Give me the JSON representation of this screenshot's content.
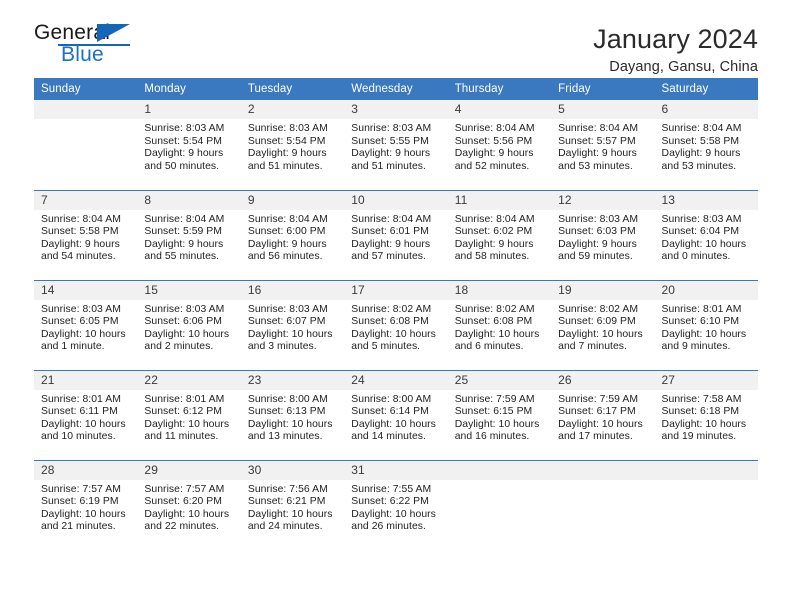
{
  "logo": {
    "word_one": "General",
    "word_two": "Blue",
    "triangle_color": "#1565b8",
    "blue_text_color": "#1c71c4"
  },
  "header": {
    "title": "January 2024",
    "location": "Dayang, Gansu, China"
  },
  "theme": {
    "header_blue": "#3a79c0",
    "daynum_gray": "#f1f1f1",
    "row_divider": "#3a79c0"
  },
  "weekday_headers": [
    "Sunday",
    "Monday",
    "Tuesday",
    "Wednesday",
    "Thursday",
    "Friday",
    "Saturday"
  ],
  "weeks": [
    [
      {
        "day": "",
        "sunrise": "",
        "sunset": "",
        "daylight_line1": "",
        "daylight_line2": ""
      },
      {
        "day": "1",
        "sunrise": "Sunrise: 8:03 AM",
        "sunset": "Sunset: 5:54 PM",
        "daylight_line1": "Daylight: 9 hours",
        "daylight_line2": "and 50 minutes."
      },
      {
        "day": "2",
        "sunrise": "Sunrise: 8:03 AM",
        "sunset": "Sunset: 5:54 PM",
        "daylight_line1": "Daylight: 9 hours",
        "daylight_line2": "and 51 minutes."
      },
      {
        "day": "3",
        "sunrise": "Sunrise: 8:03 AM",
        "sunset": "Sunset: 5:55 PM",
        "daylight_line1": "Daylight: 9 hours",
        "daylight_line2": "and 51 minutes."
      },
      {
        "day": "4",
        "sunrise": "Sunrise: 8:04 AM",
        "sunset": "Sunset: 5:56 PM",
        "daylight_line1": "Daylight: 9 hours",
        "daylight_line2": "and 52 minutes."
      },
      {
        "day": "5",
        "sunrise": "Sunrise: 8:04 AM",
        "sunset": "Sunset: 5:57 PM",
        "daylight_line1": "Daylight: 9 hours",
        "daylight_line2": "and 53 minutes."
      },
      {
        "day": "6",
        "sunrise": "Sunrise: 8:04 AM",
        "sunset": "Sunset: 5:58 PM",
        "daylight_line1": "Daylight: 9 hours",
        "daylight_line2": "and 53 minutes."
      }
    ],
    [
      {
        "day": "7",
        "sunrise": "Sunrise: 8:04 AM",
        "sunset": "Sunset: 5:58 PM",
        "daylight_line1": "Daylight: 9 hours",
        "daylight_line2": "and 54 minutes."
      },
      {
        "day": "8",
        "sunrise": "Sunrise: 8:04 AM",
        "sunset": "Sunset: 5:59 PM",
        "daylight_line1": "Daylight: 9 hours",
        "daylight_line2": "and 55 minutes."
      },
      {
        "day": "9",
        "sunrise": "Sunrise: 8:04 AM",
        "sunset": "Sunset: 6:00 PM",
        "daylight_line1": "Daylight: 9 hours",
        "daylight_line2": "and 56 minutes."
      },
      {
        "day": "10",
        "sunrise": "Sunrise: 8:04 AM",
        "sunset": "Sunset: 6:01 PM",
        "daylight_line1": "Daylight: 9 hours",
        "daylight_line2": "and 57 minutes."
      },
      {
        "day": "11",
        "sunrise": "Sunrise: 8:04 AM",
        "sunset": "Sunset: 6:02 PM",
        "daylight_line1": "Daylight: 9 hours",
        "daylight_line2": "and 58 minutes."
      },
      {
        "day": "12",
        "sunrise": "Sunrise: 8:03 AM",
        "sunset": "Sunset: 6:03 PM",
        "daylight_line1": "Daylight: 9 hours",
        "daylight_line2": "and 59 minutes."
      },
      {
        "day": "13",
        "sunrise": "Sunrise: 8:03 AM",
        "sunset": "Sunset: 6:04 PM",
        "daylight_line1": "Daylight: 10 hours",
        "daylight_line2": "and 0 minutes."
      }
    ],
    [
      {
        "day": "14",
        "sunrise": "Sunrise: 8:03 AM",
        "sunset": "Sunset: 6:05 PM",
        "daylight_line1": "Daylight: 10 hours",
        "daylight_line2": "and 1 minute."
      },
      {
        "day": "15",
        "sunrise": "Sunrise: 8:03 AM",
        "sunset": "Sunset: 6:06 PM",
        "daylight_line1": "Daylight: 10 hours",
        "daylight_line2": "and 2 minutes."
      },
      {
        "day": "16",
        "sunrise": "Sunrise: 8:03 AM",
        "sunset": "Sunset: 6:07 PM",
        "daylight_line1": "Daylight: 10 hours",
        "daylight_line2": "and 3 minutes."
      },
      {
        "day": "17",
        "sunrise": "Sunrise: 8:02 AM",
        "sunset": "Sunset: 6:08 PM",
        "daylight_line1": "Daylight: 10 hours",
        "daylight_line2": "and 5 minutes."
      },
      {
        "day": "18",
        "sunrise": "Sunrise: 8:02 AM",
        "sunset": "Sunset: 6:08 PM",
        "daylight_line1": "Daylight: 10 hours",
        "daylight_line2": "and 6 minutes."
      },
      {
        "day": "19",
        "sunrise": "Sunrise: 8:02 AM",
        "sunset": "Sunset: 6:09 PM",
        "daylight_line1": "Daylight: 10 hours",
        "daylight_line2": "and 7 minutes."
      },
      {
        "day": "20",
        "sunrise": "Sunrise: 8:01 AM",
        "sunset": "Sunset: 6:10 PM",
        "daylight_line1": "Daylight: 10 hours",
        "daylight_line2": "and 9 minutes."
      }
    ],
    [
      {
        "day": "21",
        "sunrise": "Sunrise: 8:01 AM",
        "sunset": "Sunset: 6:11 PM",
        "daylight_line1": "Daylight: 10 hours",
        "daylight_line2": "and 10 minutes."
      },
      {
        "day": "22",
        "sunrise": "Sunrise: 8:01 AM",
        "sunset": "Sunset: 6:12 PM",
        "daylight_line1": "Daylight: 10 hours",
        "daylight_line2": "and 11 minutes."
      },
      {
        "day": "23",
        "sunrise": "Sunrise: 8:00 AM",
        "sunset": "Sunset: 6:13 PM",
        "daylight_line1": "Daylight: 10 hours",
        "daylight_line2": "and 13 minutes."
      },
      {
        "day": "24",
        "sunrise": "Sunrise: 8:00 AM",
        "sunset": "Sunset: 6:14 PM",
        "daylight_line1": "Daylight: 10 hours",
        "daylight_line2": "and 14 minutes."
      },
      {
        "day": "25",
        "sunrise": "Sunrise: 7:59 AM",
        "sunset": "Sunset: 6:15 PM",
        "daylight_line1": "Daylight: 10 hours",
        "daylight_line2": "and 16 minutes."
      },
      {
        "day": "26",
        "sunrise": "Sunrise: 7:59 AM",
        "sunset": "Sunset: 6:17 PM",
        "daylight_line1": "Daylight: 10 hours",
        "daylight_line2": "and 17 minutes."
      },
      {
        "day": "27",
        "sunrise": "Sunrise: 7:58 AM",
        "sunset": "Sunset: 6:18 PM",
        "daylight_line1": "Daylight: 10 hours",
        "daylight_line2": "and 19 minutes."
      }
    ],
    [
      {
        "day": "28",
        "sunrise": "Sunrise: 7:57 AM",
        "sunset": "Sunset: 6:19 PM",
        "daylight_line1": "Daylight: 10 hours",
        "daylight_line2": "and 21 minutes."
      },
      {
        "day": "29",
        "sunrise": "Sunrise: 7:57 AM",
        "sunset": "Sunset: 6:20 PM",
        "daylight_line1": "Daylight: 10 hours",
        "daylight_line2": "and 22 minutes."
      },
      {
        "day": "30",
        "sunrise": "Sunrise: 7:56 AM",
        "sunset": "Sunset: 6:21 PM",
        "daylight_line1": "Daylight: 10 hours",
        "daylight_line2": "and 24 minutes."
      },
      {
        "day": "31",
        "sunrise": "Sunrise: 7:55 AM",
        "sunset": "Sunset: 6:22 PM",
        "daylight_line1": "Daylight: 10 hours",
        "daylight_line2": "and 26 minutes."
      },
      {
        "day": "",
        "sunrise": "",
        "sunset": "",
        "daylight_line1": "",
        "daylight_line2": ""
      },
      {
        "day": "",
        "sunrise": "",
        "sunset": "",
        "daylight_line1": "",
        "daylight_line2": ""
      },
      {
        "day": "",
        "sunrise": "",
        "sunset": "",
        "daylight_line1": "",
        "daylight_line2": ""
      }
    ]
  ]
}
